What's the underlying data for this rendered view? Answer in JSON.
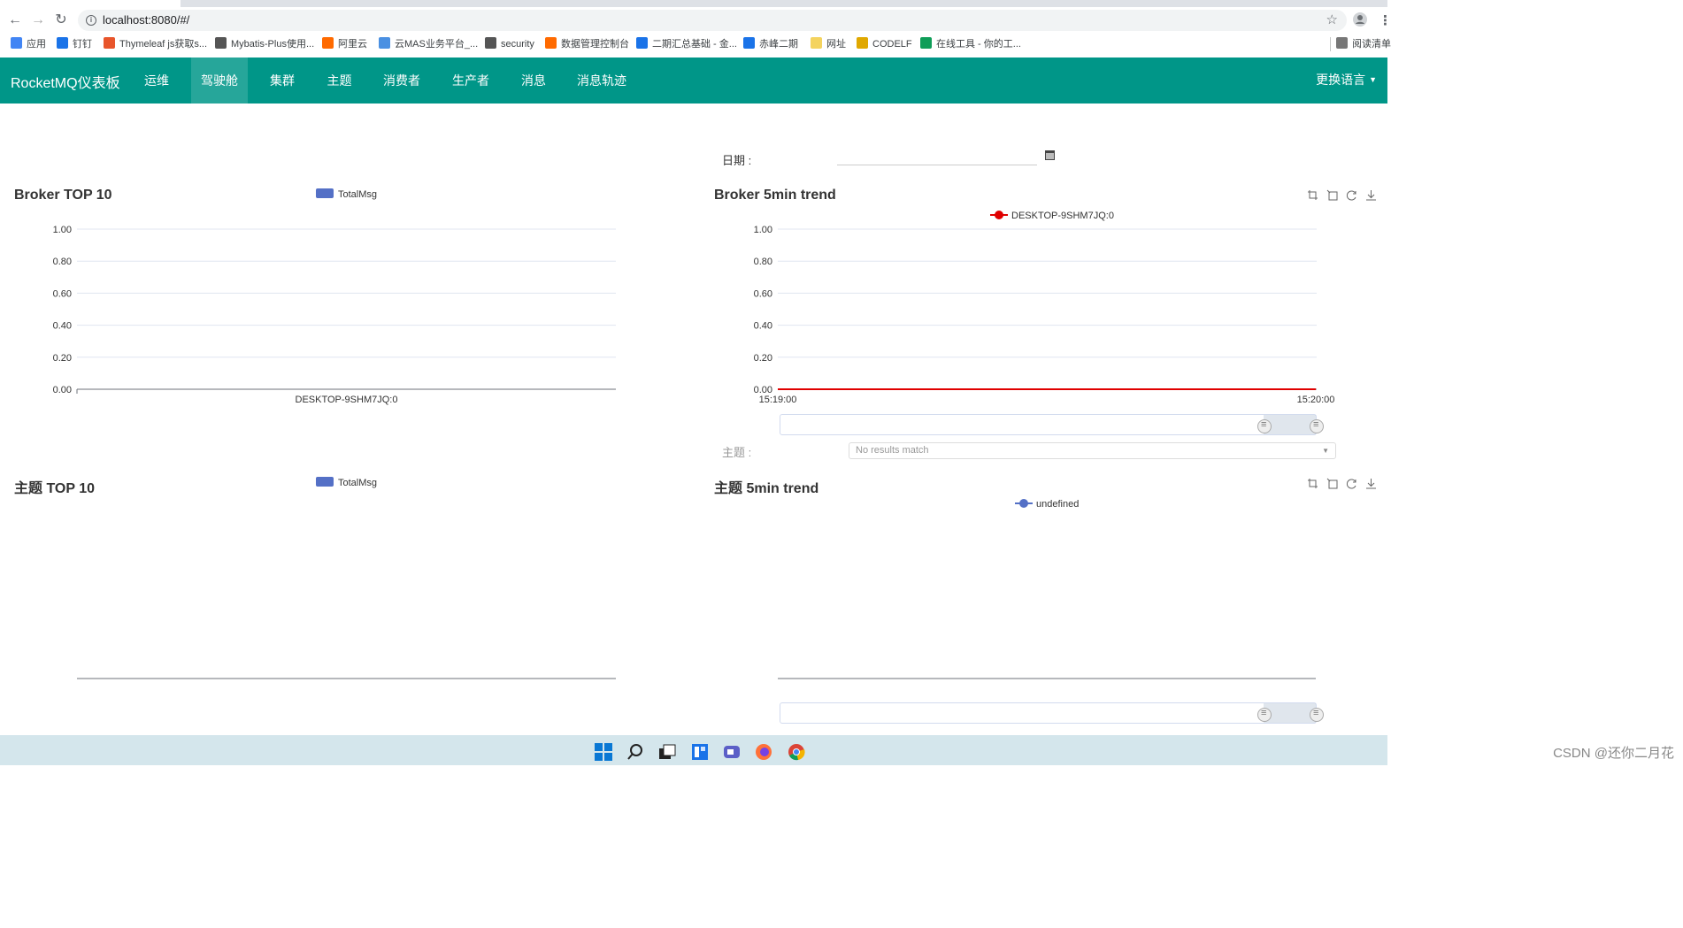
{
  "browser": {
    "url": "localhost:8080/#/",
    "bookmarks": [
      {
        "label": "应用",
        "color": "#4285f4"
      },
      {
        "label": "钉钉",
        "color": "#1a73e8"
      },
      {
        "label": "Thymeleaf js获取s...",
        "color": "#e8552b"
      },
      {
        "label": "Mybatis-Plus使用...",
        "color": "#555555"
      },
      {
        "label": "阿里云",
        "color": "#ff6a00"
      },
      {
        "label": "云MAS业务平台_...",
        "color": "#4a90e2"
      },
      {
        "label": "security",
        "color": "#555555"
      },
      {
        "label": "数据管理控制台",
        "color": "#ff6a00"
      },
      {
        "label": "二期汇总基础 - 金...",
        "color": "#1a73e8"
      },
      {
        "label": "赤峰二期",
        "color": "#1a73e8"
      },
      {
        "label": "网址",
        "color": "#f4d35e"
      },
      {
        "label": "CODELF",
        "color": "#e0a800"
      },
      {
        "label": "在线工具 - 你的工...",
        "color": "#0f9d58"
      }
    ],
    "reading_list": "阅读清单"
  },
  "navbar": {
    "brand": "RocketMQ仪表板",
    "items": [
      "运维",
      "驾驶舱",
      "集群",
      "主题",
      "消费者",
      "生产者",
      "消息",
      "消息轨迹"
    ],
    "active": "驾驶舱",
    "language": "更换语言"
  },
  "filters": {
    "date_label": "日期 :",
    "date_value": "",
    "topic_label": "主题 :",
    "topic_placeholder": "No results match"
  },
  "charts": {
    "broker_top": {
      "title": "Broker TOP 10",
      "legend": "TotalMsg"
    },
    "broker_trend": {
      "title": "Broker 5min trend",
      "legend": "DESKTOP-9SHM7JQ:0"
    },
    "topic_top": {
      "title": "主题 TOP 10",
      "legend": "TotalMsg"
    },
    "topic_trend": {
      "title": "主题 5min trend",
      "legend": "undefined"
    }
  },
  "chart_data": [
    {
      "type": "bar",
      "title": "Broker TOP 10",
      "categories": [
        "DESKTOP-9SHM7JQ:0"
      ],
      "series": [
        {
          "name": "TotalMsg",
          "values": [
            0
          ]
        }
      ],
      "yticks": [
        "0.00",
        "0.20",
        "0.40",
        "0.60",
        "0.80",
        "1.00"
      ],
      "ylim": [
        0,
        1
      ],
      "legend": "top-center",
      "color": "#5470c6"
    },
    {
      "type": "line",
      "title": "Broker 5min trend",
      "x": [
        "15:19:00",
        "15:20:00"
      ],
      "series": [
        {
          "name": "DESKTOP-9SHM7JQ:0",
          "values": [
            0,
            0
          ]
        }
      ],
      "yticks": [
        "0.00",
        "0.20",
        "0.40",
        "0.60",
        "0.80",
        "1.00"
      ],
      "ylim": [
        0,
        1
      ],
      "legend": "top-center",
      "color": "#e00000"
    },
    {
      "type": "bar",
      "title": "主题 TOP 10",
      "categories": [],
      "series": [
        {
          "name": "TotalMsg",
          "values": []
        }
      ],
      "legend": "top-center",
      "color": "#5470c6"
    },
    {
      "type": "line",
      "title": "主题 5min trend",
      "x": [],
      "series": [
        {
          "name": "undefined",
          "values": []
        }
      ],
      "legend": "top-center",
      "color": "#5470c6"
    }
  ],
  "taskbar": {
    "watermark": "CSDN @还你二月花",
    "icons": [
      "windows-start-icon",
      "search-icon",
      "task-view-icon",
      "widgets-icon",
      "chat-icon",
      "firefox-icon",
      "chrome-icon"
    ]
  }
}
